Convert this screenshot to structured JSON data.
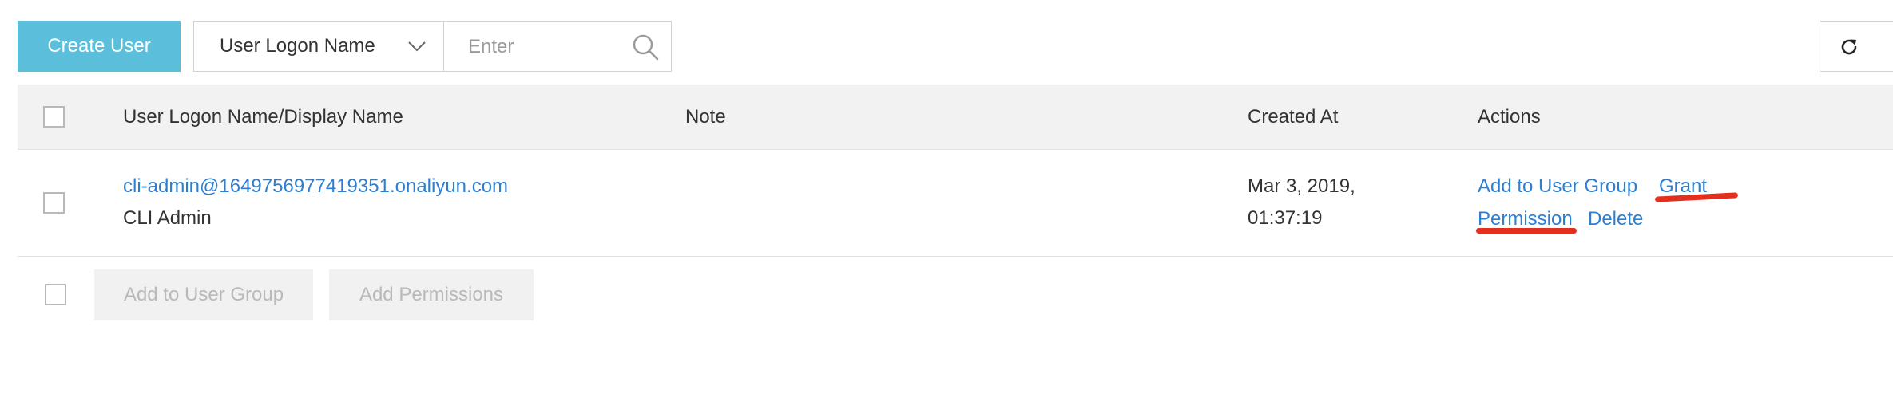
{
  "toolbar": {
    "create_user_label": "Create User",
    "filter_selected": "User Logon Name",
    "search_placeholder": "Enter"
  },
  "table": {
    "columns": [
      "User Logon Name/Display Name",
      "Note",
      "Created At",
      "Actions"
    ],
    "rows": [
      {
        "logon_name": "cli-admin@1649756977419351.onaliyun.com",
        "display_name": "CLI Admin",
        "note": "",
        "created_date": "Mar 3, 2019,",
        "created_time": "01:37:19",
        "actions": [
          "Add to User Group",
          "Grant",
          "Permission",
          "Delete"
        ]
      }
    ]
  },
  "footer": {
    "add_to_group_label": "Add to User Group",
    "add_permissions_label": "Add Permissions"
  },
  "colors": {
    "accent": "#5bbfdc",
    "link": "#2f7fd0",
    "annotation": "#e2301e",
    "header_bg": "#f2f2f2"
  },
  "icons": [
    "chevron-down-icon",
    "search-icon",
    "refresh-icon"
  ]
}
